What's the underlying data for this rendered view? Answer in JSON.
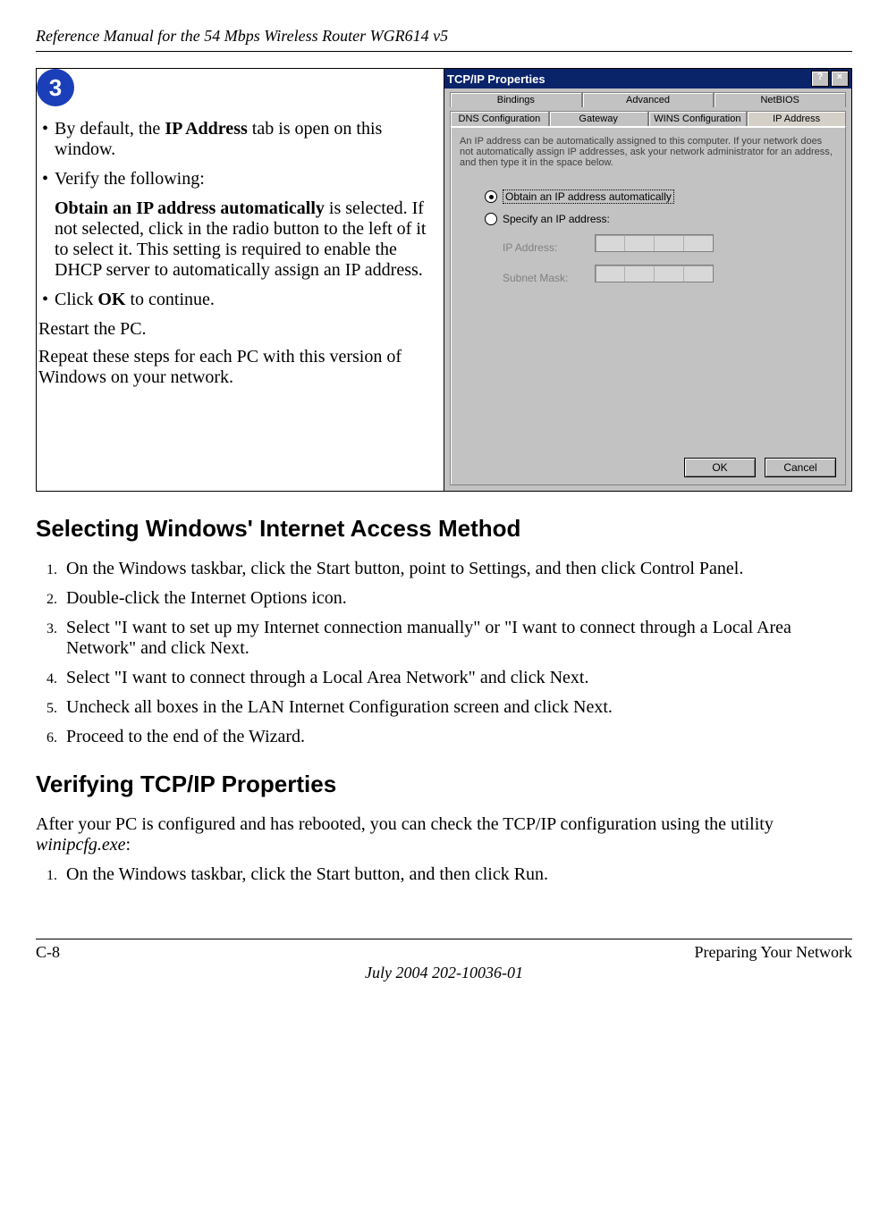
{
  "running_head": "Reference Manual for the 54 Mbps Wireless Router WGR614 v5",
  "step_badge": "3",
  "left_cell": {
    "bullet1_pre": "By default, the ",
    "bullet1_bold": "IP Address",
    "bullet1_post": " tab is open on this window.",
    "bullet2": "Verify the following:",
    "obtain_bold": "Obtain an IP address automatically",
    "obtain_rest": " is selected. If not selected, click in the radio button to the left of it to select it.  This setting is required to enable the DHCP server to automatically assign an IP address.",
    "bullet3_pre": "Click ",
    "bullet3_bold": "OK",
    "bullet3_post": " to continue.",
    "restart": "Restart the PC.",
    "repeat": "Repeat these steps for each PC with this version of Windows on your network."
  },
  "dialog": {
    "title": "TCP/IP Properties",
    "help_btn": "?",
    "close_btn": "×",
    "tabs_row1": [
      "Bindings",
      "Advanced",
      "NetBIOS"
    ],
    "tabs_row2": [
      "DNS Configuration",
      "Gateway",
      "WINS Configuration",
      "IP Address"
    ],
    "active_tab": "IP Address",
    "help_text": "An IP address can be automatically assigned to this computer. If your network does not automatically assign IP addresses, ask your network administrator for an address, and then type it in the space below.",
    "radio_obtain": "Obtain an IP address automatically",
    "radio_specify": "Specify an IP address:",
    "ip_address_label": "IP Address:",
    "subnet_label": "Subnet Mask:",
    "ok": "OK",
    "cancel": "Cancel"
  },
  "section1_title": "Selecting Windows' Internet Access Method",
  "section1_steps": [
    "On the Windows taskbar, click the Start button, point to Settings, and then click Control Panel.",
    "Double-click the Internet Options icon.",
    "Select \"I want to set up my Internet connection manually\" or \"I want to connect through a Local Area Network\" and click Next.",
    "Select \"I want to connect through a Local Area Network\" and click Next.",
    "Uncheck all boxes in the LAN Internet Configuration screen and click Next.",
    "Proceed to the end of the Wizard."
  ],
  "section2_title": "Verifying TCP/IP Properties",
  "section2_intro_pre": "After your PC is configured and has rebooted, you can check the TCP/IP configuration using the utility ",
  "section2_intro_em": "winipcfg.exe",
  "section2_intro_post": ":",
  "section2_steps": [
    "On the Windows taskbar, click the Start button, and then click Run."
  ],
  "footer": {
    "left": "C-8",
    "right": "Preparing Your Network",
    "center": "July 2004 202-10036-01"
  }
}
